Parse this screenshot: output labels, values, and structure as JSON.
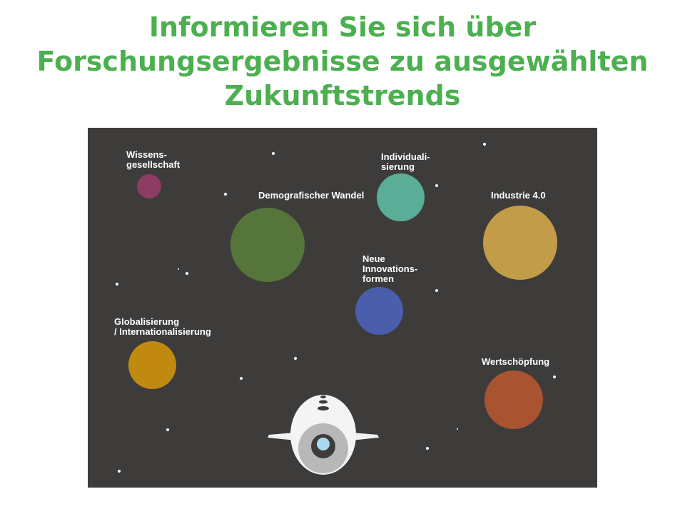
{
  "header": {
    "title_lines": [
      "Informieren Sie sich über",
      "Forschungsergebnisse zu ausgewählten",
      "Zukunftstrends"
    ],
    "accent_color": "#4caf50"
  },
  "scene": {
    "background_color": "#3d3c3b",
    "planets": [
      {
        "id": "wissensgesellschaft",
        "label_lines": [
          "Wissens-",
          "gesellschaft"
        ],
        "color": "#8e3c63"
      },
      {
        "id": "demografischer-wandel",
        "label_lines": [
          "Demografischer Wandel"
        ],
        "color": "#55753a"
      },
      {
        "id": "individualisierung",
        "label_lines": [
          "Individuali-",
          "sierung"
        ],
        "color": "#5aae97"
      },
      {
        "id": "industrie-4-0",
        "label_lines": [
          "Industrie 4.0"
        ],
        "color": "#c29c48"
      },
      {
        "id": "neue-innovationsformen",
        "label_lines": [
          "Neue",
          "Innovations-",
          "formen"
        ],
        "color": "#4a5eab"
      },
      {
        "id": "globalisierung",
        "label_lines": [
          "Globalisierung",
          "/ Internationalisierung"
        ],
        "color": "#c08a10"
      },
      {
        "id": "wertschoepfung",
        "label_lines": [
          "Wertschöpfung"
        ],
        "color": "#aa5331"
      }
    ],
    "spaceship_icon": "spaceship-icon"
  }
}
